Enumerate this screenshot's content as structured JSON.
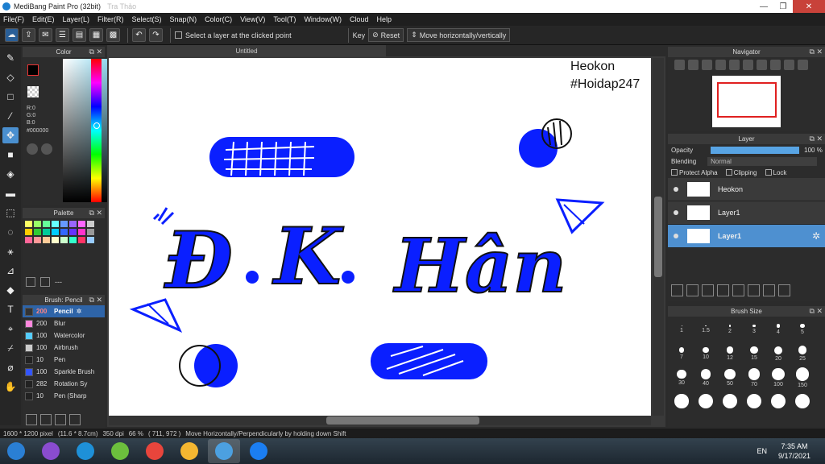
{
  "title": {
    "app": "MediBang Paint Pro (32bit)",
    "ghost": "Tra Thảo"
  },
  "menu": [
    "File(F)",
    "Edit(E)",
    "Layer(L)",
    "Filter(R)",
    "Select(S)",
    "Snap(N)",
    "Color(C)",
    "View(V)",
    "Tool(T)",
    "Window(W)",
    "Cloud",
    "Help"
  ],
  "toolbar": {
    "select_layer_label": "Select a layer at the clicked point",
    "key_label": "Key",
    "reset_label": "Reset",
    "move_label": "Move horizontally/vertically"
  },
  "color_panel": {
    "title": "Color",
    "r": "R:0",
    "g": "G:0",
    "b": "B:0",
    "hex": "#000000",
    "fg_color": "#000000",
    "bg_color": "#ff4500"
  },
  "palette_panel": {
    "title": "Palette",
    "footer_text": "---",
    "colors": [
      "#ffff66",
      "#99ff66",
      "#66ff99",
      "#66ffff",
      "#6699ff",
      "#9966ff",
      "#ff66ff",
      "#cccccc",
      "#ffcc00",
      "#33cc33",
      "#00cc99",
      "#00ccff",
      "#3366ff",
      "#6633ff",
      "#ff33cc",
      "#999999",
      "#ff6699",
      "#ff9999",
      "#ffcc99",
      "#ffffcc",
      "#ccffcc",
      "#33ffcc",
      "#ff3366",
      "#99ccff"
    ]
  },
  "brush_panel": {
    "title": "Brush: Pencil",
    "items": [
      {
        "size": "200",
        "name": "Pencil",
        "color": "#333333",
        "selected": true
      },
      {
        "size": "200",
        "name": "Blur",
        "color": "#ff88dd",
        "selected": false
      },
      {
        "size": "100",
        "name": "Watercolor",
        "color": "#55ccff",
        "selected": false
      },
      {
        "size": "100",
        "name": "Airbrush",
        "color": "#cccccc",
        "selected": false
      },
      {
        "size": "10",
        "name": "Pen",
        "color": "#222222",
        "selected": false
      },
      {
        "size": "100",
        "name": "Sparkle Brush",
        "color": "#3355ff",
        "selected": false
      },
      {
        "size": "282",
        "name": "Rotation Sy",
        "color": "#222222",
        "selected": false
      },
      {
        "size": "10",
        "name": "Pen (Sharp",
        "color": "#222222",
        "selected": false
      }
    ]
  },
  "canvas": {
    "tab_title": "Untitled",
    "sig_line1": "Heokon",
    "sig_line2": "#Hoidap247"
  },
  "navigator": {
    "title": "Navigator"
  },
  "layer_panel": {
    "title": "Layer",
    "opacity_label": "Opacity",
    "opacity_value": "100 %",
    "opacity_fraction": 1.0,
    "blending_label": "Blending",
    "blending_value": "Normal",
    "protect_alpha": "Protect Alpha",
    "clipping": "Clipping",
    "lock": "Lock",
    "layers": [
      {
        "name": "Heokon",
        "selected": false
      },
      {
        "name": "Layer1",
        "selected": false
      },
      {
        "name": "Layer1",
        "selected": true
      }
    ]
  },
  "brush_size_panel": {
    "title": "Brush Size",
    "sizes": [
      "1",
      "1.5",
      "2",
      "3",
      "4",
      "5",
      "7",
      "10",
      "12",
      "15",
      "20",
      "25",
      "30",
      "40",
      "50",
      "70",
      "100",
      "150",
      "",
      "",
      "",
      "",
      "",
      ""
    ]
  },
  "status": {
    "dimensions": "1600 * 1200 pixel",
    "physical": "(11.6 * 8.7cm)",
    "dpi": "350 dpi",
    "zoom": "66 %",
    "coords": "( 711, 972 )",
    "hint": "Move Horizontally/Perpendicularly by holding down Shift"
  },
  "tray": {
    "lang": "EN",
    "time": "7:35 AM",
    "date": "9/17/2021"
  },
  "taskbar_apps": [
    {
      "name": "start-orb",
      "color": "#2a7fd4"
    },
    {
      "name": "visual-studio",
      "color": "#8a4ccf"
    },
    {
      "name": "internet-explorer",
      "color": "#1e90d8"
    },
    {
      "name": "green-app",
      "color": "#6cbf3d"
    },
    {
      "name": "chrome",
      "color": "#e8453c"
    },
    {
      "name": "color-app",
      "color": "#f5b731"
    },
    {
      "name": "medibang",
      "color": "#4ca0e0"
    },
    {
      "name": "zalo",
      "color": "#1b7ef2"
    }
  ],
  "art": {
    "blue": "#0a1fff"
  }
}
